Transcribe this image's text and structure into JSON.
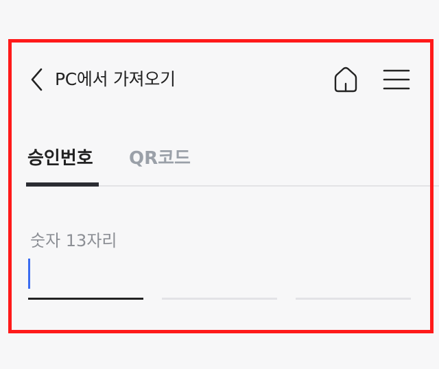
{
  "header": {
    "title": "PC에서 가져오기",
    "back_icon": "chevron-left-icon",
    "home_icon": "home-icon",
    "menu_icon": "hamburger-menu-icon"
  },
  "tabs": [
    {
      "label": "승인번호",
      "selected": true
    },
    {
      "label": "QR코드",
      "selected": false
    }
  ],
  "form": {
    "field_label": "숫자 13자리",
    "value": "",
    "segments": 3,
    "active_segment": 1
  },
  "colors": {
    "highlight_frame": "#ff1a1a",
    "caret": "#3a6cf0",
    "text_primary": "#222222",
    "text_muted": "#9aa0a8",
    "background": "#f7f7f8"
  }
}
